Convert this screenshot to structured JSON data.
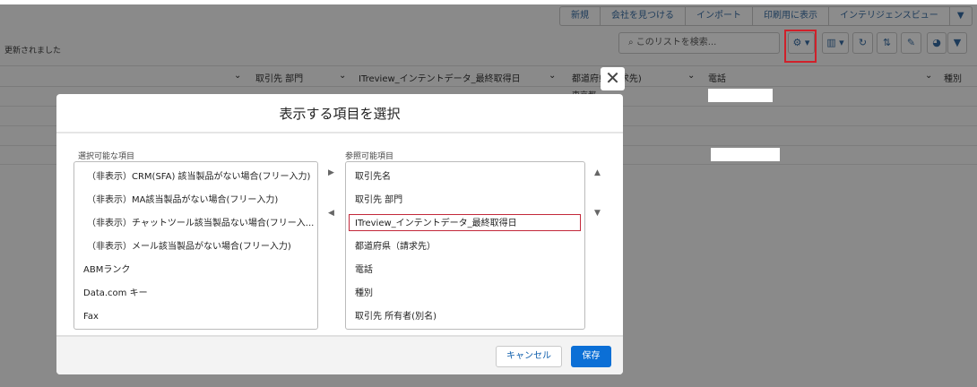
{
  "toolbar": {
    "buttons": [
      "新規",
      "会社を見つける",
      "インポート",
      "印刷用に表示",
      "インテリジェンスビュー"
    ],
    "more": "▼"
  },
  "status_text": "更新されました",
  "search": {
    "placeholder": "このリストを検索..."
  },
  "icons": {
    "search": "🔍",
    "gear": "⚙ ▾",
    "columns": "▥ ▾",
    "refresh": "↻",
    "sort": "⇅",
    "edit": "✎",
    "chart": "◕",
    "filter": "▼"
  },
  "table": {
    "columns": [
      "取引先 部門",
      "ITreview_インテントデータ_最終取得日",
      "都道府県(請求先)",
      "電話",
      "種別"
    ],
    "rows": [
      [
        "",
        "",
        "東京都",
        "",
        ""
      ]
    ]
  },
  "modal": {
    "close_icon": "✕",
    "title": "表示する項目を選択",
    "available_label": "選択可能な項目",
    "available_items": [
      "（非表示）CRM(SFA) 該当製品がない場合(フリー入力)",
      "（非表示）MA該当製品がない場合(フリー入力)",
      "（非表示）チャットツール該当製品ない場合(フリー入...",
      "（非表示）メール該当製品がない場合(フリー入力)",
      "ABMランク",
      "Data.com キー",
      "Fax"
    ],
    "visible_label": "参照可能項目",
    "visible_items": [
      "取引先名",
      "取引先 部門",
      "ITreview_インテントデータ_最終取得日",
      "都道府県（請求先）",
      "電話",
      "種別",
      "取引先 所有者(別名)"
    ],
    "selected_item": "ITreview_インテントデータ_最終取得日",
    "cancel": "キャンセル",
    "save": "保存"
  },
  "colors": {
    "accent": "#0b6fd6",
    "highlight": "#c3283a"
  }
}
